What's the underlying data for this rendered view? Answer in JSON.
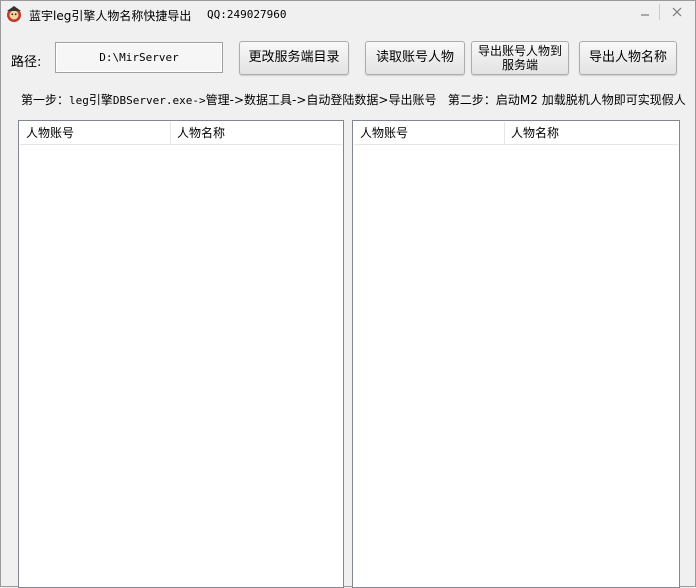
{
  "window": {
    "title": "蓝宇leg引擎人物名称快捷导出",
    "qq": "QQ:249027960",
    "minimize_icon": "minimize-icon",
    "close_icon": "close-icon"
  },
  "path": {
    "label": "路径:",
    "value": "D:\\MirServer"
  },
  "buttons": {
    "change_dir": "更改服务端目录",
    "read_accounts": "读取账号人物",
    "export_to_server": "导出账号人物到\n服务端",
    "export_names": "导出人物名称"
  },
  "steps": {
    "step1_prefix": "第一步：",
    "step1_mono": "leg",
    "step1_mid": "引擎",
    "step1_mono2": "DBServer.exe->",
    "step1_rest": "管理->数据工具->自动登陆数据>导出账号",
    "step2": "第二步：启动M2 加载脱机人物即可实现假人"
  },
  "left_list": {
    "columns": [
      "人物账号",
      "人物名称"
    ]
  },
  "right_list": {
    "columns": [
      "人物账号",
      "人物名称"
    ]
  }
}
